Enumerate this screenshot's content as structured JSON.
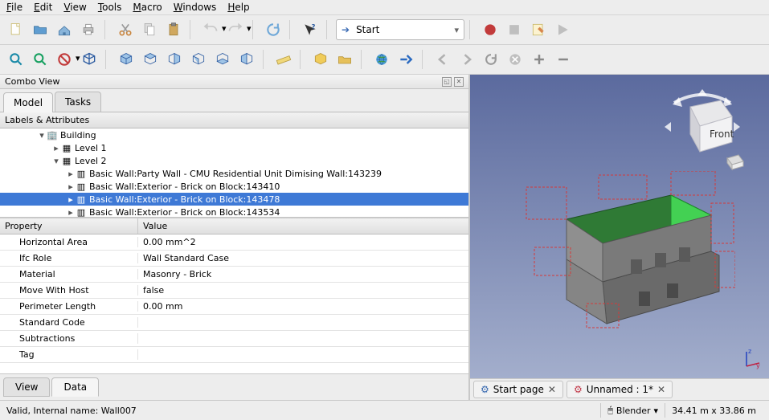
{
  "menu": {
    "file": "File",
    "edit": "Edit",
    "view": "View",
    "tools": "Tools",
    "macro": "Macro",
    "windows": "Windows",
    "help": "Help"
  },
  "workbench": {
    "label": "Start"
  },
  "combo_view": {
    "title": "Combo View",
    "tab_model": "Model",
    "tab_tasks": "Tasks",
    "la_header": "Labels & Attributes"
  },
  "tree": {
    "building": "Building",
    "level1": "Level 1",
    "level2": "Level 2",
    "w1": "Basic Wall:Party Wall - CMU Residential Unit Dimising Wall:143239",
    "w2": "Basic Wall:Exterior - Brick on Block:143410",
    "w3": "Basic Wall:Exterior - Brick on Block:143478",
    "w4": "Basic Wall:Exterior - Brick on Block:143534"
  },
  "prop_header": {
    "p": "Property",
    "v": "Value"
  },
  "props": [
    {
      "k": "Horizontal Area",
      "v": "0.00 mm^2"
    },
    {
      "k": "Ifc Role",
      "v": "Wall Standard Case"
    },
    {
      "k": "Material",
      "v": "Masonry - Brick"
    },
    {
      "k": "Move With Host",
      "v": "false"
    },
    {
      "k": "Perimeter Length",
      "v": "0.00 mm"
    },
    {
      "k": "Standard Code",
      "v": ""
    },
    {
      "k": "Subtractions",
      "v": ""
    },
    {
      "k": "Tag",
      "v": ""
    }
  ],
  "subtabs": {
    "view": "View",
    "data": "Data"
  },
  "docs": {
    "start": "Start page",
    "unnamed": "Unnamed : 1*"
  },
  "status": {
    "msg": "Valid, Internal name: Wall007",
    "mode": "Blender",
    "dims": "34.41 m x 33.86 m"
  },
  "navcube": {
    "face": "Front"
  },
  "axes": {
    "z": "z",
    "y": "y"
  }
}
